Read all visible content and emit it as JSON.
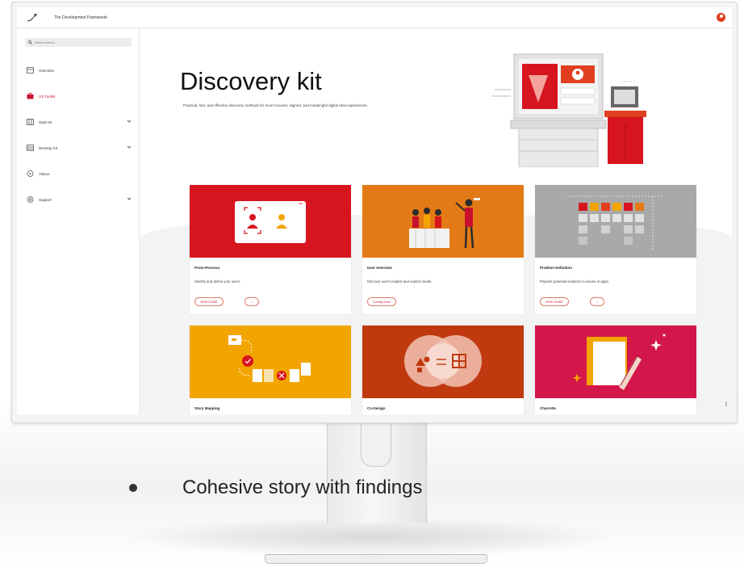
{
  "topbar": {
    "app_title": "The Development Framework"
  },
  "sidebar": {
    "search_placeholder": "Search menu...",
    "items": [
      {
        "label": "Overview",
        "icon": "overview-icon"
      },
      {
        "label": "UX Toolkit",
        "icon": "toolkit-icon",
        "active": true
      },
      {
        "label": "Style Kit",
        "icon": "style-kit-icon",
        "expandable": true
      },
      {
        "label": "Develop Kit",
        "icon": "develop-kit-icon",
        "expandable": true
      },
      {
        "label": "Videos",
        "icon": "videos-icon"
      },
      {
        "label": "Support",
        "icon": "support-icon",
        "expandable": true
      }
    ]
  },
  "hero": {
    "title": "Discovery kit",
    "description": "Practical, fast, and effective discovery methods for more focused, aligned, and meaningful digital Idea experiences."
  },
  "cards": [
    {
      "title": "Proto-Persona",
      "description": "Identify and define your users.",
      "button": "VIEW GUIDE",
      "button2": "↓",
      "color": "#d7151f"
    },
    {
      "title": "User Interview",
      "description": "Discover user's implicit and explicit needs.",
      "button": "Coming Soon",
      "color": "#e47a16"
    },
    {
      "title": "Problem Definition",
      "description": "Pinpoint potential solutions to issues or gaps.",
      "button": "VIEW GUIDE",
      "button2": "↓",
      "color": "#a9a9a9"
    },
    {
      "title": "Story Mapping",
      "color": "#f2a500"
    },
    {
      "title": "Co-Design",
      "color": "#c0390f"
    },
    {
      "title": "Charrette",
      "color": "#d4174a"
    }
  ],
  "slide": {
    "bullet": "Cohesive story with findings"
  },
  "colors": {
    "brand_red": "#c8102e",
    "accent_orange": "#e0401f"
  }
}
